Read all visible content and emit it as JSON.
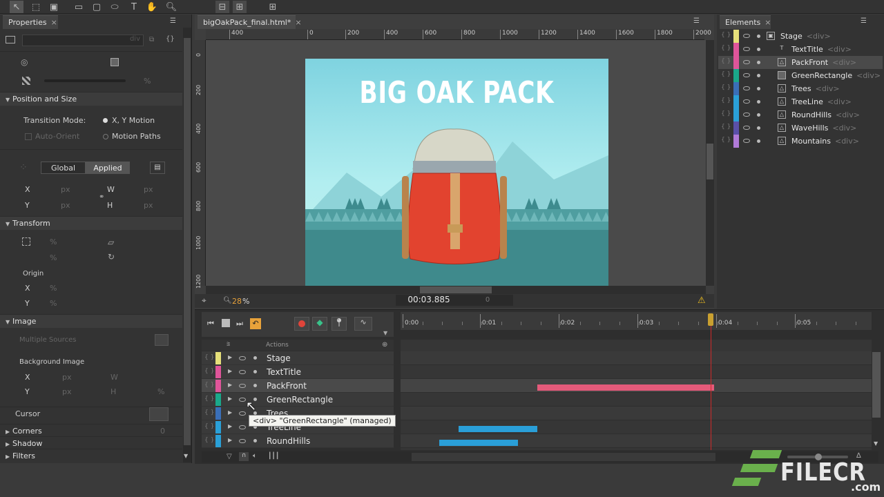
{
  "toolbar": {
    "icons": [
      "select-arrow-icon",
      "transform-icon",
      "clip-icon",
      "rectangle-icon",
      "rounded-rectangle-icon",
      "ellipse-icon",
      "text-icon",
      "hand-icon",
      "zoom-icon",
      "group-minus-icon",
      "group-square-icon",
      "grid-icon"
    ]
  },
  "properties": {
    "tab_label": "Properties",
    "div_placeholder": "div",
    "position_and_size": "Position and Size",
    "transition_mode_label": "Transition Mode:",
    "xy_motion": "X, Y Motion",
    "auto_orient": "Auto-Orient",
    "motion_paths": "Motion Paths",
    "global": "Global",
    "applied": "Applied",
    "x": "X",
    "y": "Y",
    "w": "W",
    "h": "H",
    "px": "px",
    "transform": "Transform",
    "origin": "Origin",
    "pct": "%",
    "image": "Image",
    "multiple_sources": "Multiple Sources",
    "background_image": "Background Image",
    "cursor": "Cursor",
    "corners": "Corners",
    "corners_value": "0",
    "shadow": "Shadow",
    "filters": "Filters"
  },
  "stage": {
    "tab_label": "bigOakPack_final.html*",
    "ruler_ticks": [
      "400",
      "0",
      "200",
      "400",
      "600",
      "800",
      "1000",
      "1200",
      "1400",
      "1600",
      "1800",
      "2000"
    ],
    "vruler_ticks": [
      "0",
      "200",
      "400",
      "600",
      "800",
      "1000",
      "1200"
    ],
    "canvas_title": "BIG OAK PACK",
    "zoom": "28",
    "zoom_unit": "%",
    "timecode": "00:03.885",
    "frame": "0"
  },
  "elements": {
    "tab_label": "Elements",
    "items": [
      {
        "name": "Stage",
        "tag": "<div>",
        "color": "#e6e07a",
        "icon": "stage-icon"
      },
      {
        "name": "TextTitle",
        "tag": "<div>",
        "color": "#e0559a",
        "icon": "text-icon"
      },
      {
        "name": "PackFront",
        "tag": "<div>",
        "color": "#e0559a",
        "icon": "image-icon"
      },
      {
        "name": "GreenRectangle",
        "tag": "<div>",
        "color": "#1aa88a",
        "icon": "rect-icon"
      },
      {
        "name": "Trees",
        "tag": "<div>",
        "color": "#3a6fb8",
        "icon": "image-icon"
      },
      {
        "name": "TreeLine",
        "tag": "<div>",
        "color": "#2aa0d8",
        "icon": "image-icon"
      },
      {
        "name": "RoundHills",
        "tag": "<div>",
        "color": "#2aa0d8",
        "icon": "image-icon"
      },
      {
        "name": "WaveHills",
        "tag": "<div>",
        "color": "#5a50a8",
        "icon": "image-icon"
      },
      {
        "name": "Mountains",
        "tag": "<div>",
        "color": "#b07ad8",
        "icon": "image-icon"
      }
    ]
  },
  "timeline": {
    "actions_label": "Actions",
    "time_ticks": [
      "0:00",
      "0:01",
      "0:02",
      "0:03",
      "0:04",
      "0:05"
    ],
    "rows": [
      {
        "name": "Stage",
        "color": "#e6e07a"
      },
      {
        "name": "TextTitle",
        "color": "#e0559a"
      },
      {
        "name": "PackFront",
        "color": "#e0559a"
      },
      {
        "name": "GreenRectangle",
        "color": "#1aa88a"
      },
      {
        "name": "Trees",
        "color": "#3a6fb8"
      },
      {
        "name": "TreeLine",
        "color": "#2aa0d8"
      },
      {
        "name": "RoundHills",
        "color": "#2aa0d8"
      }
    ],
    "tooltip": "<div> \"GreenRectangle\" (managed)"
  },
  "watermark": {
    "text": "FILECR",
    "sub": ".com"
  }
}
